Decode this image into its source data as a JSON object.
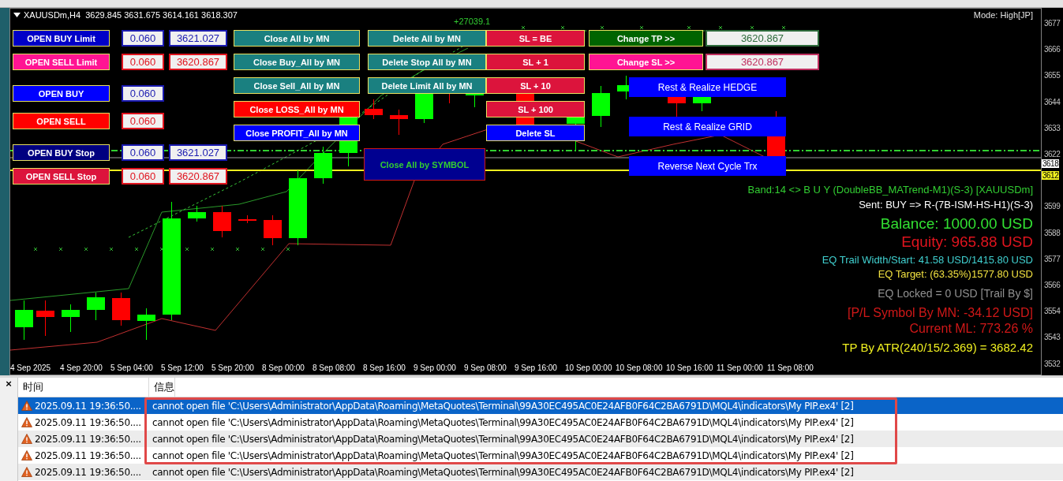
{
  "chart": {
    "title": "XAUUSDm,H4  3629.845 3631.675 3614.161 3618.307",
    "mode": "Mode: High[JP]",
    "profit_label": "+27039.1",
    "controls": [
      {
        "kind": "button",
        "label": "OPEN BUY Limit",
        "color": "#0000c8"
      },
      {
        "kind": "field",
        "value": "0.060",
        "color": "#1a1ab0"
      },
      {
        "kind": "field",
        "value": "3621.027",
        "color": "#1a1ab0"
      },
      {
        "kind": "button",
        "label": "Close All by MN",
        "color": "#1a8080"
      },
      {
        "kind": "button",
        "label": "Delete All by MN",
        "color": "#1a8080"
      },
      {
        "kind": "button",
        "label": "SL = BE",
        "color": "#dc143c"
      },
      {
        "kind": "button",
        "label": "Change TP >>",
        "color": "#006400"
      },
      {
        "kind": "field",
        "value": "3620.867",
        "color": "#2e6b3c"
      },
      {
        "kind": "button",
        "label": "OPEN SELL Limit",
        "color": "#ff1493"
      },
      {
        "kind": "field",
        "value": "0.060",
        "color": "#e0141e"
      },
      {
        "kind": "field",
        "value": "3620.867",
        "color": "#e0141e"
      },
      {
        "kind": "button",
        "label": "Close Buy_All by MN",
        "color": "#1a8080"
      },
      {
        "kind": "button",
        "label": "Delete Stop All by MN",
        "color": "#1a8080"
      },
      {
        "kind": "button",
        "label": "SL + 1",
        "color": "#dc143c"
      },
      {
        "kind": "button",
        "label": "Change SL >>",
        "color": "#ff1493"
      },
      {
        "kind": "field",
        "value": "3620.867",
        "color": "#c03060"
      },
      {
        "kind": "button",
        "label": "OPEN BUY",
        "color": "#0000ff"
      },
      {
        "kind": "field",
        "value": "0.060",
        "color": "#1a1ab0"
      },
      {
        "kind": "button",
        "label": "Close Sell_All by MN",
        "color": "#1a8080"
      },
      {
        "kind": "button",
        "label": "Delete Limit All by MN",
        "color": "#1a8080"
      },
      {
        "kind": "button",
        "label": "SL + 10",
        "color": "#dc143c"
      },
      {
        "kind": "flat",
        "label": "Rest & Realize HEDGE",
        "color": "#0000ff"
      },
      {
        "kind": "button",
        "label": "Close LOSS_All by MN",
        "color": "#ff0000"
      },
      {
        "kind": "button",
        "label": "SL + 100",
        "color": "#dc143c"
      },
      {
        "kind": "button",
        "label": "OPEN SELL",
        "color": "#ff0000"
      },
      {
        "kind": "field",
        "value": "0.060",
        "color": "#e0141e"
      },
      {
        "kind": "button",
        "label": "Close PROFIT_All by MN",
        "color": "#0000ff"
      },
      {
        "kind": "button",
        "label": "Delete SL",
        "color": "#0000ff"
      },
      {
        "kind": "flat",
        "label": "Rest & Realize GRID",
        "color": "#0000ff"
      },
      {
        "kind": "button",
        "label": "OPEN BUY Stop",
        "color": "#000080"
      },
      {
        "kind": "field",
        "value": "0.060",
        "color": "#1a1ab0"
      },
      {
        "kind": "field",
        "value": "3621.027",
        "color": "#1a1ab0"
      },
      {
        "kind": "outlined",
        "label": "Close All by SYMBOL",
        "color": "#000090"
      },
      {
        "kind": "flat",
        "label": "Reverse Next Cycle Trx",
        "color": "#0000ff"
      },
      {
        "kind": "button",
        "label": "OPEN SELL Stop",
        "color": "#dc143c"
      },
      {
        "kind": "field",
        "value": "0.060",
        "color": "#e0141e"
      },
      {
        "kind": "field",
        "value": "3620.867",
        "color": "#e0141e"
      }
    ],
    "info_lines": [
      {
        "text": "Band:14 <> B U Y (DoubleBB_MATrend-M1)(S-3)  [XAUUSDm]",
        "color": "#32cd32"
      },
      {
        "text": "Sent: BUY => R-(7B-ISM-HS-H1)(S-3)",
        "color": "#ffffff"
      },
      {
        "text": "Balance: 1000.00 USD",
        "color": "#32e032"
      },
      {
        "text": "Equity: 965.88 USD",
        "color": "#e0141e"
      },
      {
        "text": "EQ Trail Width/Start: 41.58 USD/1415.80 USD",
        "color": "#40d0d0"
      },
      {
        "text": "EQ Target: (63.35%)1577.80 USD",
        "color": "#f0e040"
      },
      {
        "text": "EQ Locked = 0 USD [Trail By $]",
        "color": "#909090"
      },
      {
        "text": "[P/L Symbol By MN: -34.12 USD]",
        "color": "#d01818"
      },
      {
        "text": "Current ML: 773.26 %",
        "color": "#d01818"
      },
      {
        "text": "TP By ATR(240/15/2.369) = 3682.42",
        "color": "#f0f020"
      }
    ],
    "price_axis": [
      {
        "kind": "tick",
        "label": "3677"
      },
      {
        "kind": "tick",
        "label": "3666"
      },
      {
        "kind": "tick",
        "label": "3655"
      },
      {
        "kind": "tick",
        "label": "3644"
      },
      {
        "kind": "tick",
        "label": "3633"
      },
      {
        "kind": "tick",
        "label": "3622"
      },
      {
        "kind": "bid",
        "label": "3618"
      },
      {
        "kind": "line",
        "label": "3612"
      },
      {
        "kind": "tick",
        "label": "3599"
      },
      {
        "kind": "tick",
        "label": "3588"
      },
      {
        "kind": "tick",
        "label": "3577"
      },
      {
        "kind": "tick",
        "label": "3566"
      },
      {
        "kind": "tick",
        "label": "3554"
      },
      {
        "kind": "tick",
        "label": "3543"
      },
      {
        "kind": "tick",
        "label": "3532"
      }
    ],
    "time_axis": [
      "4 Sep 2025",
      "4 Sep 20:00",
      "5 Sep 04:00",
      "5 Sep 12:00",
      "5 Sep 20:00",
      "8 Sep 00:00",
      "8 Sep 08:00",
      "8 Sep 16:00",
      "9 Sep 00:00",
      "9 Sep 08:00",
      "9 Sep 16:00",
      "10 Sep 00:00",
      "10 Sep 08:00",
      "10 Sep 16:00",
      "11 Sep 00:00",
      "11 Sep 08:00"
    ]
  },
  "journal": {
    "close": "×",
    "columns": [
      "时间",
      "信息"
    ],
    "rows": [
      {
        "time": "2025.09.11 19:36:50....",
        "message": "cannot open file 'C:\\Users\\Administrator\\AppData\\Roaming\\MetaQuotes\\Terminal\\99A30EC495AC0E24AFB0F64C2BA6791D\\MQL4\\indicators\\My PIP.ex4' [2]",
        "selected": true
      },
      {
        "time": "2025.09.11 19:36:50....",
        "message": "cannot open file 'C:\\Users\\Administrator\\AppData\\Roaming\\MetaQuotes\\Terminal\\99A30EC495AC0E24AFB0F64C2BA6791D\\MQL4\\indicators\\My PIP.ex4' [2]",
        "selected": false
      },
      {
        "time": "2025.09.11 19:36:50....",
        "message": "cannot open file 'C:\\Users\\Administrator\\AppData\\Roaming\\MetaQuotes\\Terminal\\99A30EC495AC0E24AFB0F64C2BA6791D\\MQL4\\indicators\\My PIP.ex4' [2]",
        "selected": false
      },
      {
        "time": "2025.09.11 19:36:50....",
        "message": "cannot open file 'C:\\Users\\Administrator\\AppData\\Roaming\\MetaQuotes\\Terminal\\99A30EC495AC0E24AFB0F64C2BA6791D\\MQL4\\indicators\\My PIP.ex4' [2]",
        "selected": false
      },
      {
        "time": "2025.09.11 19:36:50....",
        "message": "cannot open file 'C:\\Users\\Administrator\\AppData\\Roaming\\MetaQuotes\\Terminal\\99A30EC495AC0E24AFB0F64C2BA6791D\\MQL4\\indicators\\My PIP.ex4' [2]",
        "selected": false
      }
    ]
  }
}
